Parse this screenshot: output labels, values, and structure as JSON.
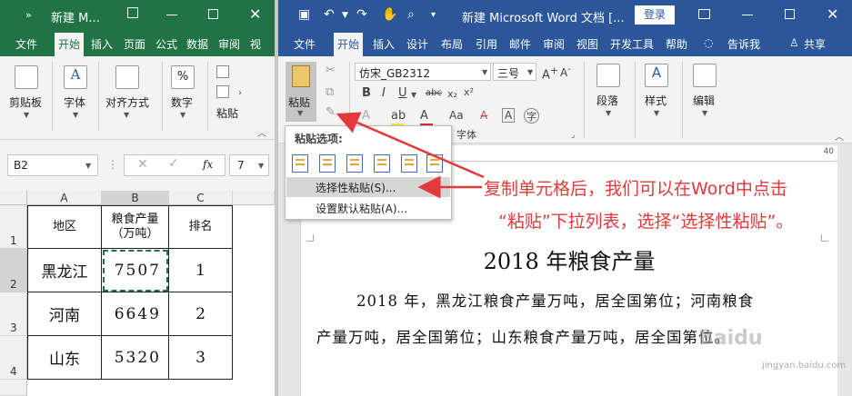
{
  "excel": {
    "title": "新建 M...",
    "tabs": [
      "文件",
      "开始",
      "插入",
      "页面",
      "公式",
      "数据",
      "审阅",
      "视"
    ],
    "active_tab": "开始",
    "ribbon_groups": [
      "剪贴板",
      "字体",
      "对齐方式",
      "数字"
    ],
    "paste_label": "粘贴",
    "name_box": "B2",
    "fx": "fx",
    "zoom_value": "7",
    "columns": [
      "A",
      "B",
      "C"
    ],
    "rows": [
      "1",
      "2",
      "3",
      "4"
    ],
    "header": {
      "region": "地区",
      "output_line1": "粮食产量",
      "output_line2": "（万吨）",
      "rank": "排名"
    },
    "data": [
      {
        "region": "黑龙江",
        "output": "7507",
        "rank": "1"
      },
      {
        "region": "河南",
        "output": "6649",
        "rank": "2"
      },
      {
        "region": "山东",
        "output": "5320",
        "rank": "3"
      }
    ]
  },
  "word": {
    "title": "新建 Microsoft Word 文档 [...",
    "login": "登录",
    "tabs": [
      "文件",
      "开始",
      "插入",
      "设计",
      "布局",
      "引用",
      "邮件",
      "审阅",
      "视图",
      "开发工具",
      "帮助"
    ],
    "active_tab": "开始",
    "tell_me": "告诉我",
    "share": "共享",
    "font_name": "仿宋_GB2312",
    "font_size": "三号",
    "paste_label": "粘贴",
    "font_group_label": "字体",
    "paragraph_label": "段落",
    "styles_label": "样式",
    "editing_label": "编辑",
    "ruler_number": "40",
    "paste_menu": {
      "header": "粘贴选项:",
      "items": [
        "选择性粘贴(S)...",
        "设置默认粘贴(A)..."
      ]
    },
    "doc_title": "2018 年粮食产量",
    "para_line1": "2018 年，黑龙江粮食产量万吨，居全国第位；河南粮食",
    "para_line2": "产量万吨，居全国第位；山东粮食产量万吨，居全国第位。"
  },
  "annotation": {
    "line1": "复制单元格后，我们可以在Word中点击",
    "line2": "“粘贴”下拉列表，选择“选择性粘贴”。"
  },
  "watermark": {
    "text": "Baidu",
    "url": "jingyan.baidu.com"
  },
  "colors": {
    "excel_green": "#217346",
    "word_blue": "#2b579a",
    "annotation_red": "#e23a3a"
  }
}
